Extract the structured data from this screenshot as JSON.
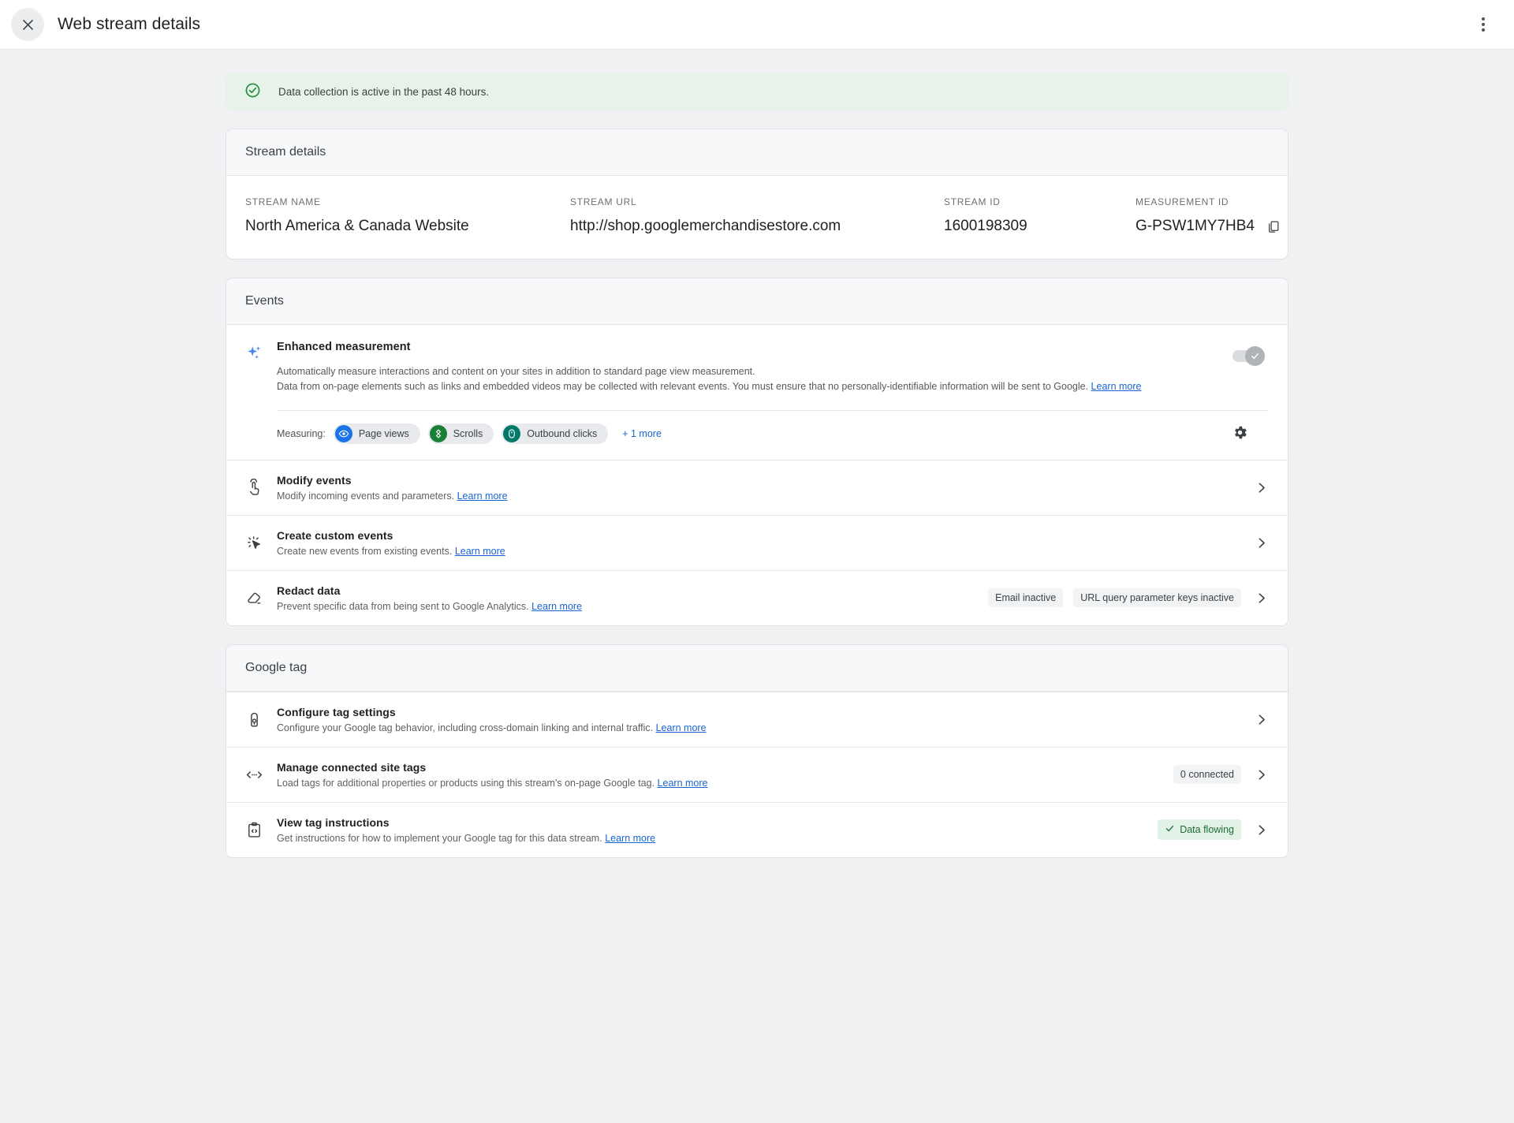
{
  "topbar": {
    "close_icon": "close-icon",
    "title": "Web stream details",
    "menu_icon": "more-options-icon"
  },
  "banner": {
    "icon": "check-circle-icon",
    "text": "Data collection is active in the past 48 hours.",
    "background": "#e7f3e9",
    "icon_color": "#1e8e3e"
  },
  "stream_details": {
    "section_title": "Stream details",
    "fields": [
      {
        "label": "STREAM NAME",
        "value": "North America & Canada Website"
      },
      {
        "label": "STREAM URL",
        "value": "http://shop.googlemerchandisestore.com"
      },
      {
        "label": "STREAM ID",
        "value": "1600198309"
      },
      {
        "label": "MEASUREMENT ID",
        "value": "G-PSW1MY7HB4",
        "copy_icon": "copy-icon"
      }
    ]
  },
  "events": {
    "section_title": "Events",
    "enhanced_measurement": {
      "icon": "sparkle-icon",
      "title": "Enhanced measurement",
      "description_line1": "Automatically measure interactions and content on your sites in addition to standard page view measurement.",
      "description_line2": "Data from on-page elements such as links and embedded videos may be collected with relevant events. You must ensure that no personally-identifiable information will be sent to Google.",
      "learn_more": "Learn more",
      "toggle_state": "on",
      "measuring_label": "Measuring:",
      "chips": [
        {
          "label": "Page views",
          "icon": "eye-icon",
          "color": "#1a73e8"
        },
        {
          "label": "Scrolls",
          "icon": "scroll-target-icon",
          "color": "#188038"
        },
        {
          "label": "Outbound clicks",
          "icon": "mouse-icon",
          "color": "#00796b"
        }
      ],
      "more_label": "+ 1 more",
      "settings_icon": "gear-icon"
    },
    "rows": [
      {
        "icon": "touch-pointer-icon",
        "title": "Modify events",
        "subtitle": "Modify incoming events and parameters.",
        "learn_more": "Learn more",
        "pills": []
      },
      {
        "icon": "click-cursor-icon",
        "title": "Create custom events",
        "subtitle": "Create new events from existing events.",
        "learn_more": "Learn more",
        "pills": []
      },
      {
        "icon": "eraser-icon",
        "title": "Redact data",
        "subtitle": "Prevent specific data from being sent to Google Analytics.",
        "learn_more": "Learn more",
        "pills": [
          {
            "label": "Email inactive",
            "style": "grey"
          },
          {
            "label": "URL query parameter keys inactive",
            "style": "grey"
          }
        ]
      }
    ]
  },
  "google_tag": {
    "section_title": "Google tag",
    "rows": [
      {
        "icon": "tag-icon",
        "title": "Configure tag settings",
        "subtitle": "Configure your Google tag behavior, including cross-domain linking and internal traffic.",
        "learn_more": "Learn more",
        "pills": []
      },
      {
        "icon": "code-brackets-icon",
        "title": "Manage connected site tags",
        "subtitle": "Load tags for additional properties or products using this stream's on-page Google tag.",
        "learn_more": "Learn more",
        "pills": [
          {
            "label": "0 connected",
            "style": "grey"
          }
        ]
      },
      {
        "icon": "clipboard-code-icon",
        "title": "View tag instructions",
        "subtitle": "Get instructions for how to implement your Google tag for this data stream.",
        "learn_more": "Learn more",
        "pills": [
          {
            "label": "Data flowing",
            "style": "green",
            "icon": "check-icon"
          }
        ]
      }
    ]
  },
  "colors": {
    "page_background": "#f0f1f3",
    "card_background": "#ffffff",
    "link": "#1a64d4",
    "success": "#1e8e3e"
  }
}
